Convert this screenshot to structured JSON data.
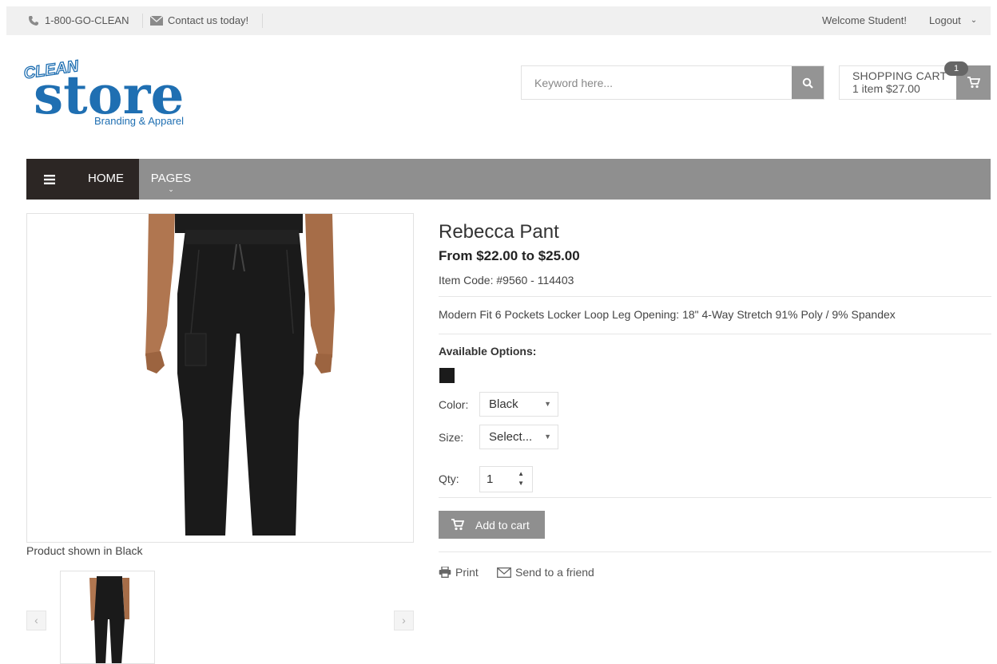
{
  "topbar": {
    "phone": "1-800-GO-CLEAN",
    "contact": "Contact us today!",
    "welcome": "Welcome Student!",
    "logout": "Logout"
  },
  "logo": {
    "brand_top": "CLEAN",
    "brand_main": "store",
    "tagline": "Branding & Apparel"
  },
  "search": {
    "placeholder": "Keyword here..."
  },
  "cart": {
    "title": "SHOPPING CART",
    "summary": "1 item $27.00",
    "badge": "1"
  },
  "nav": {
    "home": "HOME",
    "pages": "PAGES"
  },
  "product": {
    "title": "Rebecca Pant",
    "price": "From $22.00 to $25.00",
    "item_code": "Item Code: #9560 - 114403",
    "description": "Modern Fit 6 Pockets Locker Loop Leg Opening: 18\" 4-Way Stretch 91% Poly / 9% Spandex",
    "options_heading": "Available Options:",
    "swatch_color": "#1b1b1b",
    "color_label": "Color:",
    "color_value": "Black",
    "size_label": "Size:",
    "size_value": "Select...",
    "qty_label": "Qty:",
    "qty_value": "1",
    "add_to_cart": "Add to cart",
    "print": "Print",
    "send": "Send to a friend",
    "image_caption": "Product shown in Black"
  },
  "colors": {
    "nav_bg": "#8f8f8f",
    "nav_active": "#2c2624",
    "logo_blue": "#1f6fb2",
    "button_gray": "#8f8f8f"
  }
}
